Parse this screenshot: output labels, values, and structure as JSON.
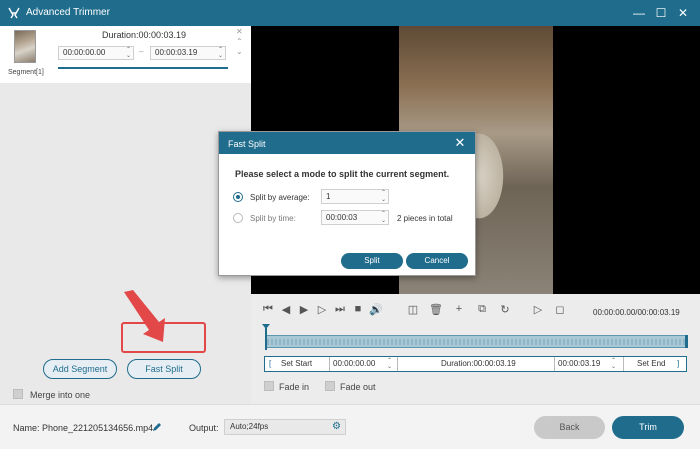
{
  "window": {
    "title": "Advanced Trimmer",
    "controls": [
      "minimize",
      "maximize",
      "close"
    ]
  },
  "segment": {
    "label": "Segment[1]",
    "duration": "Duration:00:00:03.19",
    "start": "00:00:00.00",
    "end": "00:00:03.19",
    "dash": "–"
  },
  "left_actions": {
    "add_segment": "Add Segment",
    "fast_split": "Fast Split",
    "merge_label": "Merge into one"
  },
  "player": {
    "time_display": "00:00:00.00/00:00:03.19",
    "set_start": "Set Start",
    "start_time": "00:00:00.00",
    "duration": "Duration:00:00:03.19",
    "end_time": "00:00:03.19",
    "set_end": "Set End",
    "fade_in": "Fade in",
    "fade_out": "Fade out"
  },
  "footer": {
    "name": "Name: Phone_221205134656.mp4",
    "output_label": "Output:",
    "output_value": "Auto;24fps",
    "back": "Back",
    "trim": "Trim"
  },
  "dialog": {
    "title": "Fast Split",
    "prompt": "Please select a mode to split the current segment.",
    "mode_average": "Split by average:",
    "average_value": "1",
    "mode_time": "Split by time:",
    "time_value": "00:00:03",
    "pieces_text": "2 pieces in total",
    "selected_mode": "average",
    "split": "Split",
    "cancel": "Cancel"
  },
  "colors": {
    "accent": "#1f6c8c",
    "highlight": "#e24848"
  }
}
